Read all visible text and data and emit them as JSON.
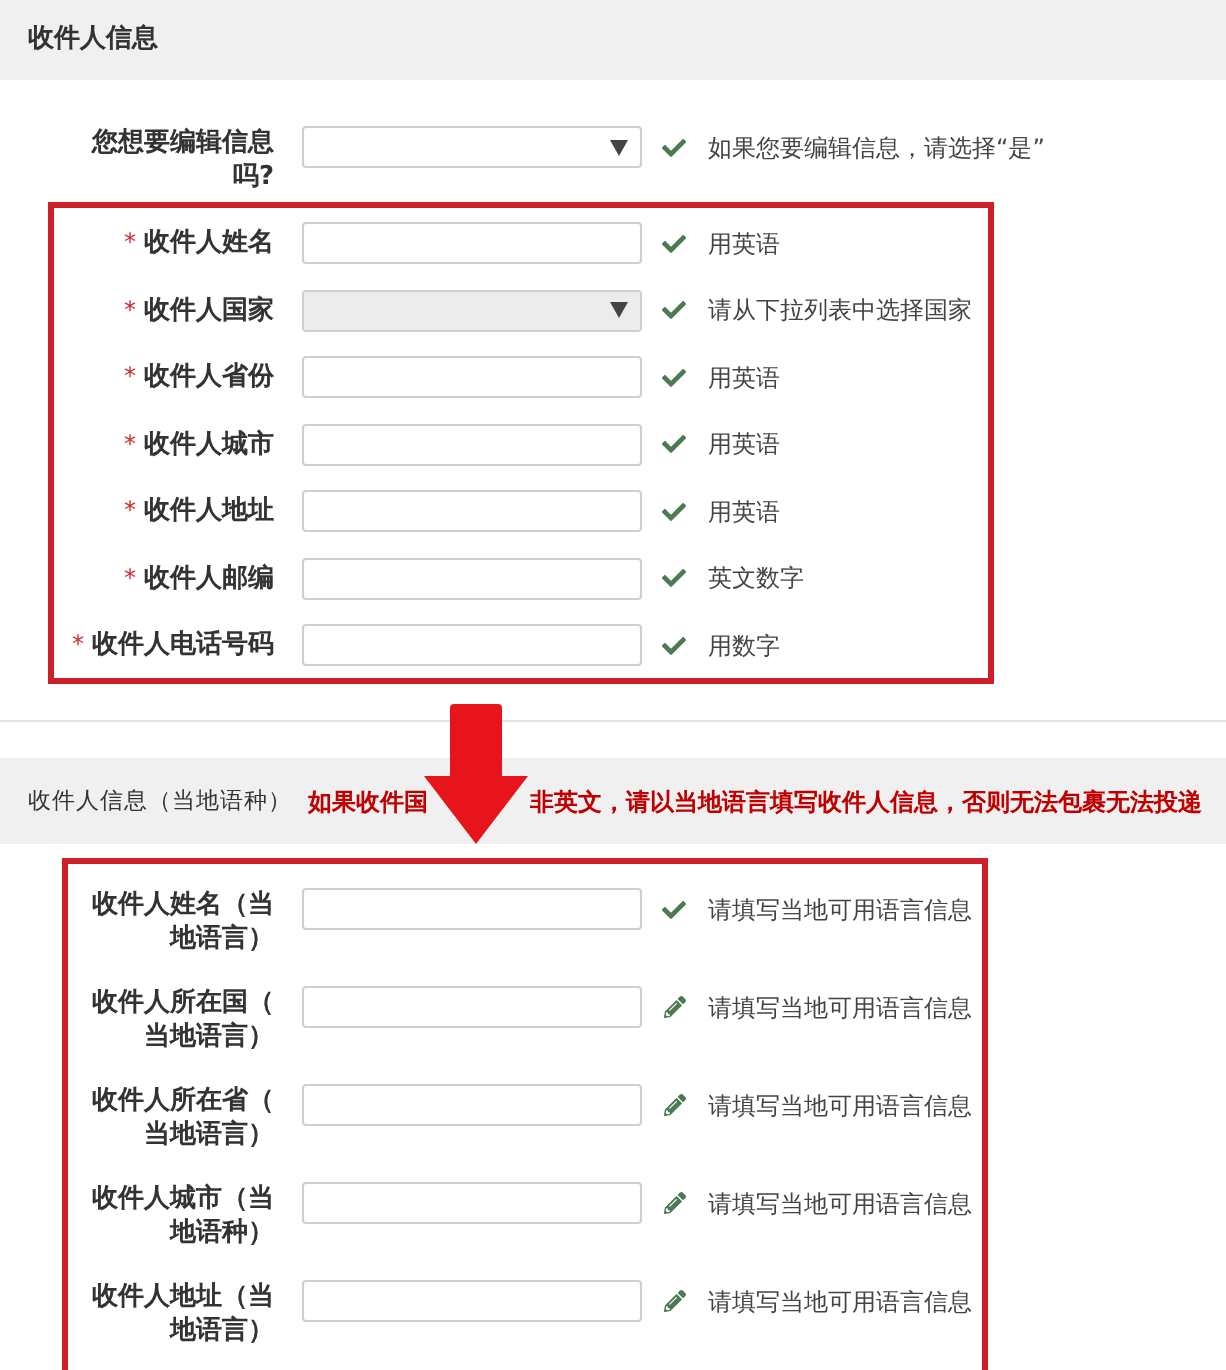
{
  "section1": {
    "title": "收件人信息",
    "question": {
      "label": "您想要编辑信息吗?",
      "kind": "select",
      "disabled": false,
      "valid": true,
      "help": "如果您要编辑信息，请选择“是”"
    },
    "fields": [
      {
        "mark": "*",
        "label": "收件人姓名",
        "kind": "text",
        "disabled": false,
        "valid": true,
        "help": "用英语"
      },
      {
        "mark": "*",
        "label": "收件人国家",
        "kind": "select",
        "disabled": true,
        "valid": true,
        "help": "请从下拉列表中选择国家"
      },
      {
        "mark": "*",
        "label": "收件人省份",
        "kind": "text",
        "disabled": false,
        "valid": true,
        "help": "用英语"
      },
      {
        "mark": "*",
        "label": "收件人城市",
        "kind": "text",
        "disabled": false,
        "valid": true,
        "help": "用英语"
      },
      {
        "mark": "*",
        "label": "收件人地址",
        "kind": "text",
        "disabled": false,
        "valid": true,
        "help": "用英语"
      },
      {
        "mark": "*",
        "label": "收件人邮编",
        "kind": "text",
        "disabled": false,
        "valid": true,
        "help": "英文数字"
      },
      {
        "mark": "*",
        "label": "收件人电话号码",
        "kind": "text",
        "disabled": false,
        "valid": true,
        "help": "用数字"
      }
    ]
  },
  "section2": {
    "title": "收件人信息（当地语种）",
    "notice": [
      "如果收件国",
      "非英文，请以当地语言填写收件人信息，否则无法包裹无法投递"
    ],
    "fields": [
      {
        "label": "收件人姓名（当地语言）",
        "kind": "text",
        "disabled": false,
        "valid": true,
        "help": "请填写当地可用语言信息"
      },
      {
        "label": "收件人所在国（当地语言）",
        "kind": "text",
        "disabled": false,
        "valid": false,
        "help": "请填写当地可用语言信息"
      },
      {
        "label": "收件人所在省（当地语言）",
        "kind": "text",
        "disabled": false,
        "valid": false,
        "help": "请填写当地可用语言信息"
      },
      {
        "label": "收件人城市（当地语种）",
        "kind": "text",
        "disabled": false,
        "valid": false,
        "help": "请填写当地可用语言信息"
      },
      {
        "label": "收件人地址（当地语言）",
        "kind": "text",
        "disabled": false,
        "valid": false,
        "help": "请填写当地可用语言信息"
      }
    ]
  }
}
